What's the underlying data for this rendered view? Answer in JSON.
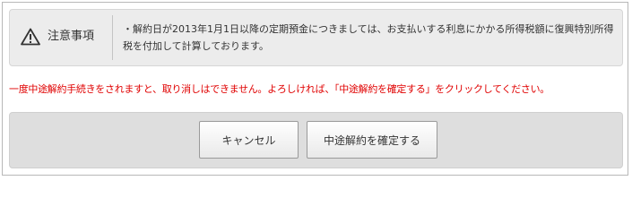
{
  "notice": {
    "icon": "warning-triangle-icon",
    "title": "注意事項",
    "body": "・解約日が2013年1月1日以降の定期預金につきましては、お支払いする利息にかかる所得税額に復興特別所得税を付加して計算しております。"
  },
  "warning": {
    "text": "一度中途解約手続きをされますと、取り消しはできません。よろしければ、「中途解約を確定する」をクリックしてください。",
    "color": "#e00000"
  },
  "buttons": {
    "cancel_label": "キャンセル",
    "confirm_label": "中途解約を確定する"
  }
}
